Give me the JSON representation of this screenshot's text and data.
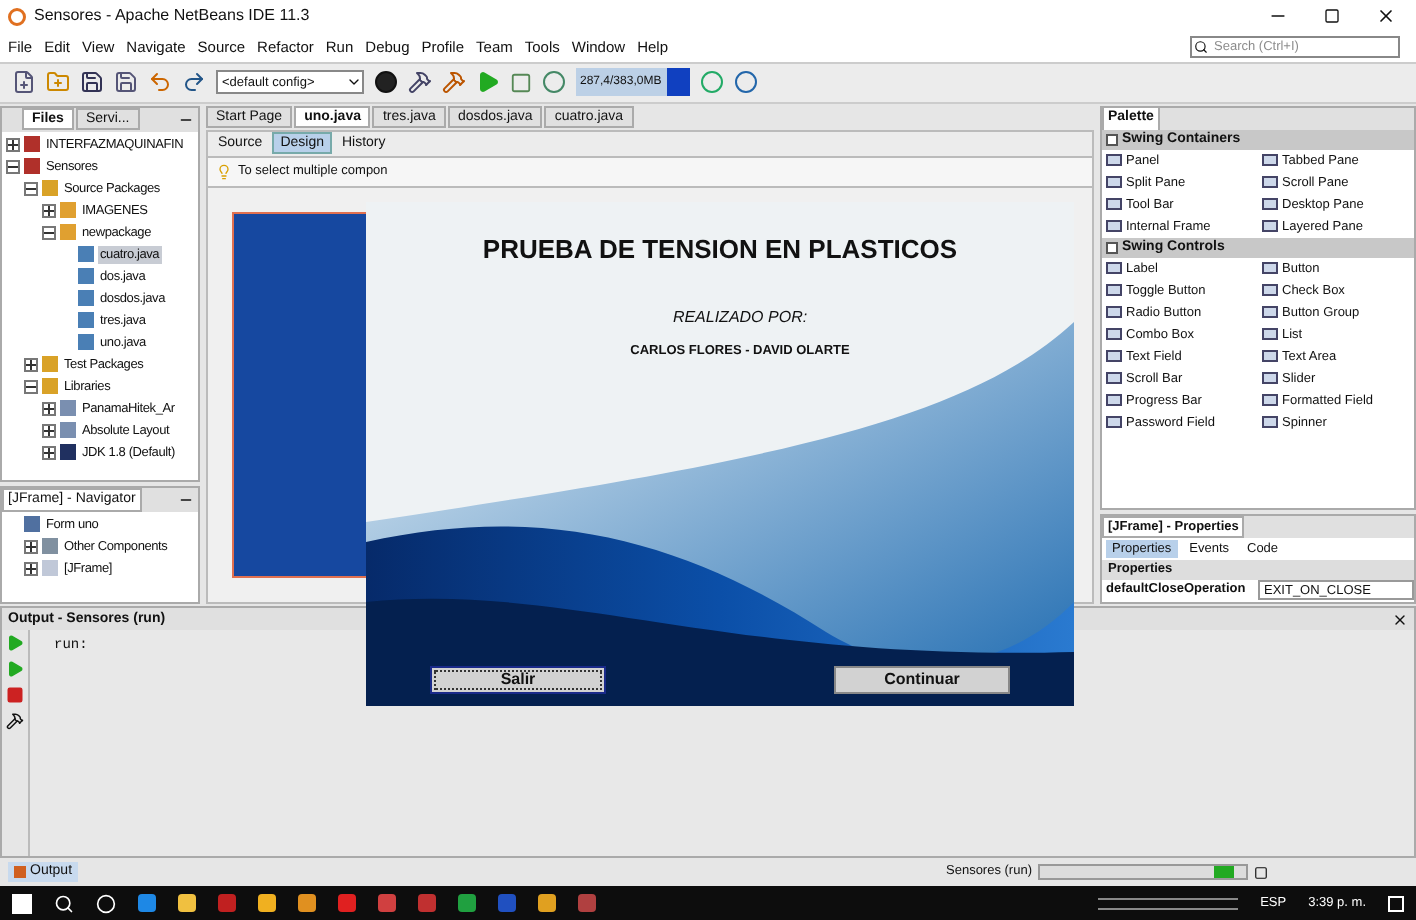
{
  "window": {
    "title": "Sensores - Apache NetBeans IDE 11.3"
  },
  "menu": [
    "File",
    "Edit",
    "View",
    "Navigate",
    "Source",
    "Refactor",
    "Run",
    "Debug",
    "Profile",
    "Team",
    "Tools",
    "Window",
    "Help"
  ],
  "search": {
    "placeholder": "Search (Ctrl+I)"
  },
  "toolbar": {
    "config": "<default config>",
    "memory": "287,4/383,0MB"
  },
  "projects_panel": {
    "tabs": [
      {
        "label": "Files",
        "selected": true
      },
      {
        "label": "Servi...",
        "selected": false
      }
    ],
    "tree": [
      {
        "label": "INTERFAZMAQUINAFIN",
        "kind": "project",
        "expanded": false,
        "selected": false
      },
      {
        "label": "Sensores",
        "kind": "project",
        "expanded": true,
        "selected": false,
        "children": [
          {
            "label": "Source Packages",
            "kind": "folder",
            "expanded": true,
            "selected": false,
            "children": [
              {
                "label": "IMAGENES",
                "kind": "package",
                "expanded": false,
                "selected": false
              },
              {
                "label": "newpackage",
                "kind": "package",
                "expanded": true,
                "selected": false,
                "children": [
                  {
                    "label": "cuatro.java",
                    "kind": "file",
                    "selected": true
                  },
                  {
                    "label": "dos.java",
                    "kind": "file",
                    "selected": false
                  },
                  {
                    "label": "dosdos.java",
                    "kind": "file",
                    "selected": false
                  },
                  {
                    "label": "tres.java",
                    "kind": "file",
                    "selected": false
                  },
                  {
                    "label": "uno.java",
                    "kind": "file",
                    "selected": false
                  }
                ]
              }
            ]
          },
          {
            "label": "Test Packages",
            "kind": "folder",
            "expanded": false,
            "selected": false
          },
          {
            "label": "Libraries",
            "kind": "folder",
            "expanded": true,
            "selected": false,
            "children": [
              {
                "label": "PanamaHitek_Ar",
                "kind": "library",
                "expanded": false,
                "selected": false
              },
              {
                "label": "Absolute Layout",
                "kind": "library",
                "expanded": false,
                "selected": false
              },
              {
                "label": "JDK 1.8 (Default)",
                "kind": "jdk",
                "expanded": false,
                "selected": false
              }
            ]
          }
        ]
      }
    ]
  },
  "navigator": {
    "title": "[JFrame] - Navigator",
    "tree": [
      {
        "label": "Form uno",
        "kind": "form",
        "children": [
          {
            "label": "Other Components",
            "kind": "other",
            "expanded": false
          },
          {
            "label": "[JFrame]",
            "kind": "frame",
            "expanded": false
          }
        ]
      }
    ]
  },
  "editor": {
    "tabs": [
      {
        "label": "Start Page",
        "selected": false
      },
      {
        "label": "uno.java",
        "selected": true
      },
      {
        "label": "tres.java",
        "selected": false
      },
      {
        "label": "dosdos.java",
        "selected": false
      },
      {
        "label": "cuatro.java",
        "selected": false
      }
    ],
    "views": [
      {
        "label": "Source",
        "selected": false
      },
      {
        "label": "Design",
        "selected": true
      },
      {
        "label": "History",
        "selected": false
      }
    ],
    "hint": "To select multiple compon"
  },
  "palette": {
    "title": "Palette",
    "sections": [
      {
        "name": "Swing Containers",
        "expanded": true,
        "items": [
          "Panel",
          "Tabbed Pane",
          "Split Pane",
          "Scroll Pane",
          "Tool Bar",
          "Desktop Pane",
          "Internal Frame",
          "Layered Pane"
        ]
      },
      {
        "name": "Swing Controls",
        "expanded": true,
        "items": [
          "Label",
          "Button",
          "Toggle Button",
          "Check Box",
          "Radio Button",
          "Button Group",
          "Combo Box",
          "List",
          "Text Field",
          "Text Area",
          "Scroll Bar",
          "Slider",
          "Progress Bar",
          "Formatted Field",
          "Password Field",
          "Spinner"
        ]
      }
    ]
  },
  "properties": {
    "title": "[JFrame] - Properties",
    "tabs": [
      {
        "label": "Properties",
        "selected": true
      },
      {
        "label": "Events",
        "selected": false
      },
      {
        "label": "Code",
        "selected": false
      }
    ],
    "section": "Properties",
    "rows": [
      {
        "name": "defaultCloseOperation",
        "value": "EXIT_ON_CLOSE"
      }
    ]
  },
  "output": {
    "title": "Output - Sensores (run)",
    "lines": [
      "run:"
    ]
  },
  "status_bar": {
    "tab": "Output",
    "task": "Sensores (run)"
  },
  "dialog": {
    "title": "PRUEBA DE TENSION EN PLASTICOS",
    "subtitle": "REALIZADO POR:",
    "authors": "CARLOS FLORES - DAVID OLARTE",
    "buttons": [
      {
        "label": "Salir",
        "focused": true
      },
      {
        "label": "Continuar",
        "focused": false
      }
    ]
  },
  "taskbar": {
    "language": "ESP",
    "time": "3:39 p. m."
  }
}
